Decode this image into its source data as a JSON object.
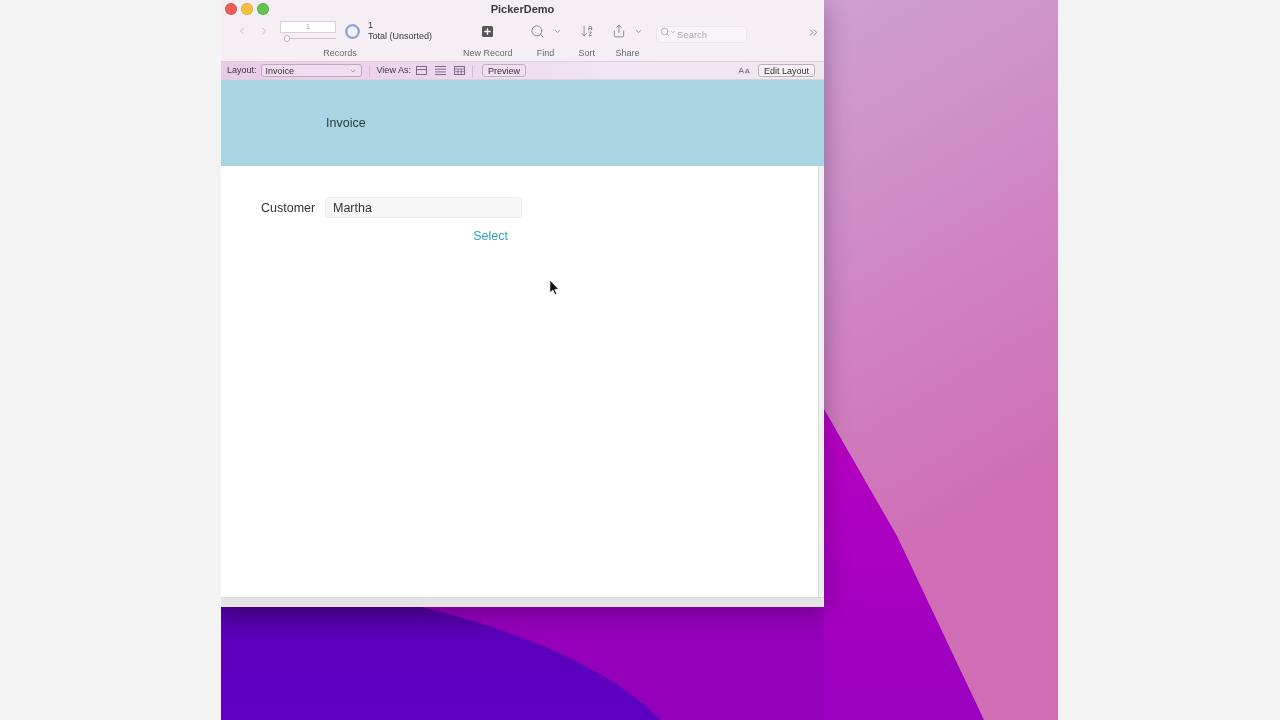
{
  "window": {
    "title": "PickerDemo"
  },
  "toolbar": {
    "record_number": "1",
    "record_slider": {
      "level": 0
    },
    "found_count": "1",
    "found_status": "Total (Unsorted)",
    "records_label": "Records",
    "items": [
      {
        "kind": "new-record",
        "label": "New Record",
        "dropdown": false
      },
      {
        "kind": "find",
        "label": "Find",
        "dropdown": true
      },
      {
        "kind": "sort",
        "label": "Sort",
        "dropdown": false
      },
      {
        "kind": "share",
        "label": "Share",
        "dropdown": true
      }
    ],
    "search": {
      "placeholder": "Search"
    }
  },
  "layout_bar": {
    "layout_label": "Layout:",
    "layout_value": "Invoice",
    "view_as_label": "View As:",
    "view_modes": [
      {
        "kind": "form"
      },
      {
        "kind": "list"
      },
      {
        "kind": "table"
      }
    ],
    "preview_button": "Preview",
    "edit_layout_button": "Edit Layout"
  },
  "header": {
    "title": "Invoice"
  },
  "form": {
    "fields": [
      {
        "label": "Customer",
        "value": "Martha"
      }
    ],
    "select_button": "Select"
  }
}
